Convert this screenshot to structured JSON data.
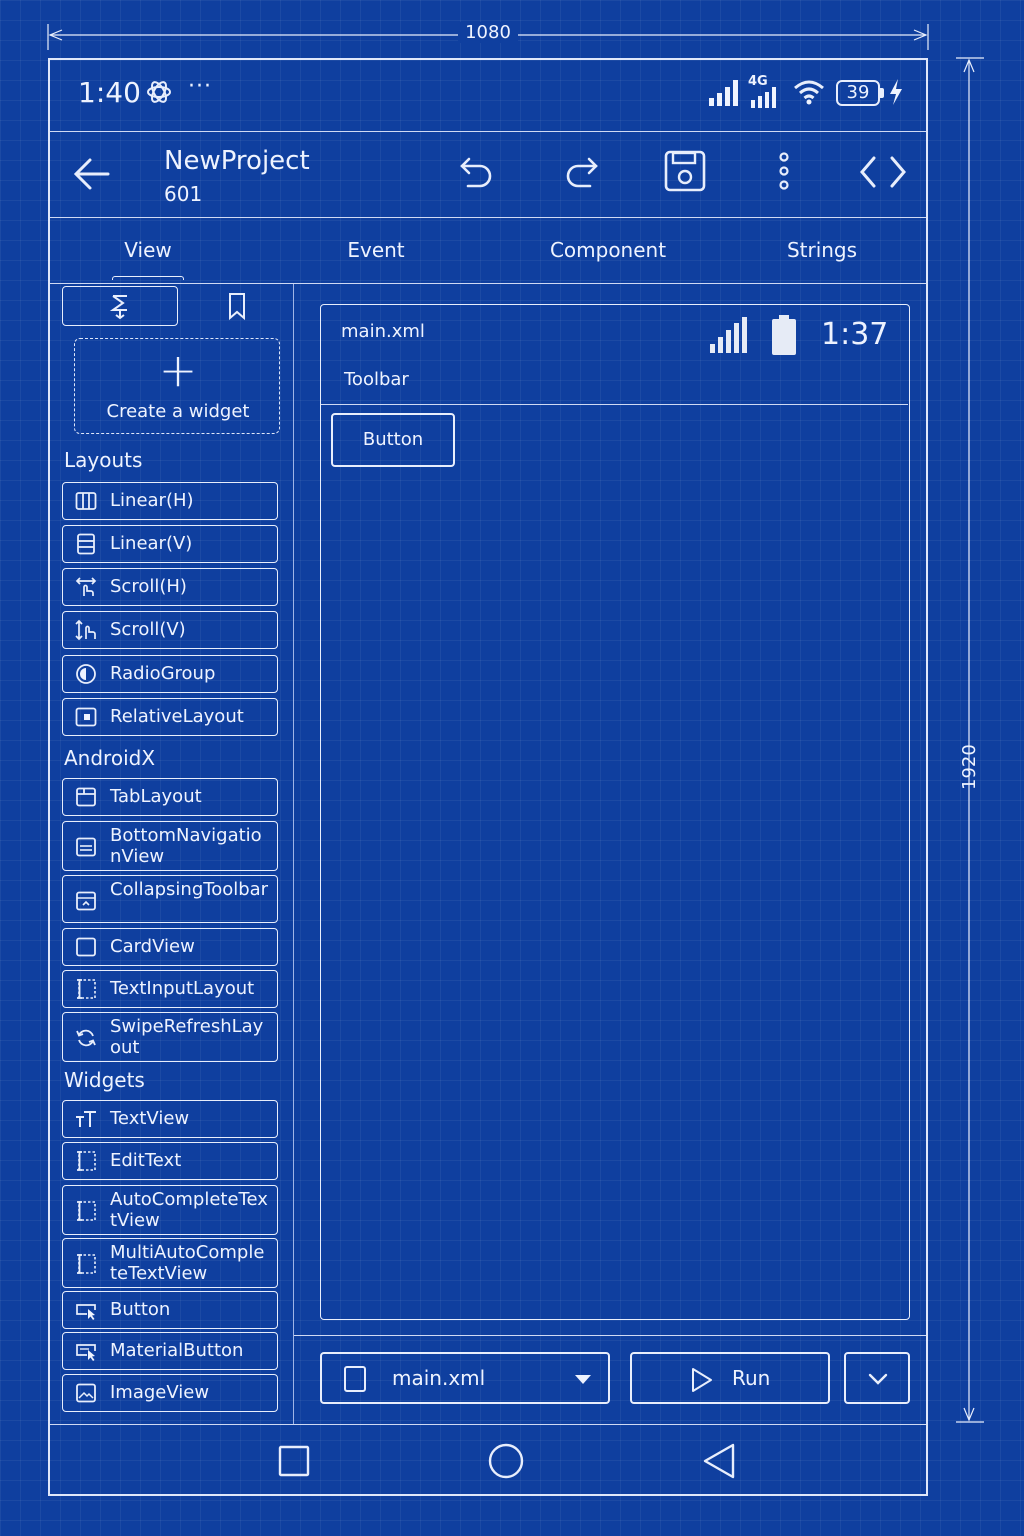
{
  "dimensions": {
    "width_label": "1080",
    "height_label": "1920"
  },
  "status_bar": {
    "time": "1:40",
    "overflow": "···",
    "network_type": "4G",
    "battery_level": "39",
    "icons": [
      "openai-icon",
      "signal-icon",
      "signal-4g-icon",
      "wifi-icon",
      "battery-icon",
      "charging-icon"
    ]
  },
  "app_bar": {
    "project_name": "NewProject",
    "project_id": "601",
    "icons": [
      "back-arrow-icon",
      "undo-icon",
      "redo-icon",
      "save-icon",
      "more-vert-icon",
      "code-icon"
    ]
  },
  "tabs": [
    {
      "label": "View",
      "selected": true
    },
    {
      "label": "Event"
    },
    {
      "label": "Component"
    },
    {
      "label": "Strings"
    }
  ],
  "palette": {
    "create_widget_label": "Create a widget",
    "sections": [
      {
        "title": "Layouts",
        "items": [
          {
            "label": "Linear(H)",
            "icon": "linear-horizontal-icon"
          },
          {
            "label": "Linear(V)",
            "icon": "linear-vertical-icon"
          },
          {
            "label": "Scroll(H)",
            "icon": "scroll-horizontal-icon"
          },
          {
            "label": "Scroll(V)",
            "icon": "scroll-vertical-icon"
          },
          {
            "label": "RadioGroup",
            "icon": "radio-group-icon"
          },
          {
            "label": "RelativeLayout",
            "icon": "relative-layout-icon"
          }
        ]
      },
      {
        "title": "AndroidX",
        "items": [
          {
            "label": "TabLayout",
            "icon": "tab-layout-icon"
          },
          {
            "label": "BottomNavigationView",
            "icon": "bottom-navigation-icon"
          },
          {
            "label": "CollapsingToolbar",
            "icon": "collapsing-toolbar-icon"
          },
          {
            "label": "CardView",
            "icon": "card-view-icon"
          },
          {
            "label": "TextInputLayout",
            "icon": "text-input-layout-icon"
          },
          {
            "label": "SwipeRefreshLayout",
            "icon": "swipe-refresh-icon"
          }
        ]
      },
      {
        "title": "Widgets",
        "items": [
          {
            "label": "TextView",
            "icon": "text-view-icon"
          },
          {
            "label": "EditText",
            "icon": "edit-text-icon"
          },
          {
            "label": "AutoCompleteTextView",
            "icon": "autocomplete-icon"
          },
          {
            "label": "MultiAutoCompleteTextView",
            "icon": "multi-autocomplete-icon"
          },
          {
            "label": "Button",
            "icon": "button-icon"
          },
          {
            "label": "MaterialButton",
            "icon": "material-button-icon"
          },
          {
            "label": "ImageView",
            "icon": "image-view-icon"
          }
        ]
      }
    ]
  },
  "preview": {
    "file_name": "main.xml",
    "toolbar_label": "Toolbar",
    "time": "1:37",
    "button_label": "Button"
  },
  "action_bar": {
    "selected_file": "main.xml",
    "run_label": "Run"
  },
  "nav_bar": {
    "icons": [
      "recents-square-icon",
      "home-circle-icon",
      "back-triangle-icon"
    ]
  }
}
